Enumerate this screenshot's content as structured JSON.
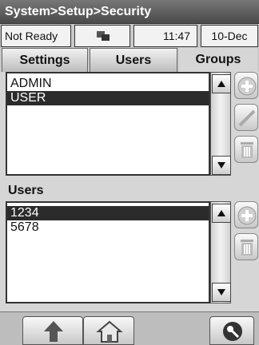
{
  "header": {
    "breadcrumb": "System>Setup>Security"
  },
  "status_bar": {
    "state": "Not Ready",
    "time": "11:47",
    "date": "10-Dec",
    "icon": "connection-icon"
  },
  "tabs": [
    {
      "label": "Settings",
      "active": false
    },
    {
      "label": "Users",
      "active": false
    },
    {
      "label": "Groups",
      "active": true
    }
  ],
  "groups": {
    "items": [
      {
        "label": "ADMIN",
        "selected": false
      },
      {
        "label": "USER",
        "selected": true
      }
    ]
  },
  "users": {
    "section_label": "Users",
    "items": [
      {
        "label": "1234",
        "selected": true
      },
      {
        "label": "5678",
        "selected": false
      }
    ]
  },
  "icons": {
    "add": "plus-icon",
    "edit": "pencil-icon",
    "delete": "trash-icon",
    "scroll_up": "arrow-up-icon",
    "scroll_down": "arrow-down-icon",
    "back": "arrow-up-icon",
    "home": "home-icon",
    "key": "key-icon"
  }
}
